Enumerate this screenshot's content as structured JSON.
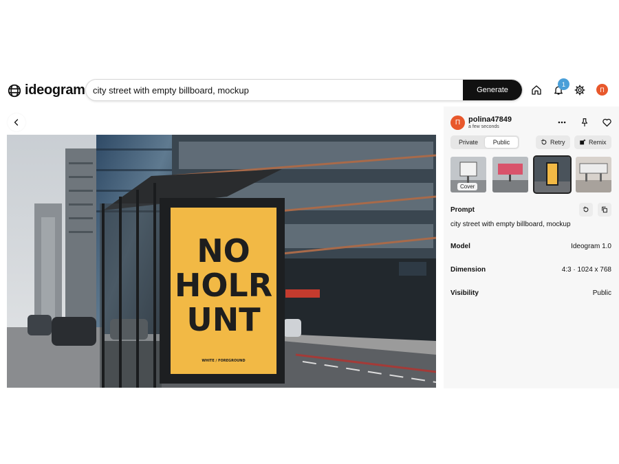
{
  "app": {
    "logo_text": "ideogram"
  },
  "search": {
    "value": "city street with empty billboard, mockup",
    "generate_label": "Generate"
  },
  "header": {
    "notification_count": "1",
    "avatar_initial": "Π"
  },
  "image": {
    "poster_lines": [
      "NO",
      "HOLR",
      "UNT"
    ],
    "poster_small_text": "WHITE / FOREGROUND"
  },
  "panel": {
    "user": {
      "avatar_initial": "Π",
      "username": "polina47849",
      "timestamp": "a few seconds"
    },
    "visibility_options": [
      "Private",
      "Public"
    ],
    "retry_label": "Retry",
    "remix_label": "Remix",
    "cover_label": "Cover",
    "prompt_label": "Prompt",
    "prompt_text": "city street with empty billboard, mockup",
    "model_label": "Model",
    "model_value": "Ideogram 1.0",
    "dimension_label": "Dimension",
    "dimension_value": "4:3 · 1024 x 768",
    "visibility_label": "Visibility",
    "visibility_value": "Public"
  },
  "colors": {
    "accent_dark": "#111111",
    "avatar": "#e8582c",
    "badge": "#4a9fd8",
    "poster_yellow": "#f2b945"
  },
  "icons": [
    "logo-icon",
    "home-icon",
    "bell-icon",
    "gear-icon",
    "chevron-left-icon",
    "more-icon",
    "pin-icon",
    "heart-icon",
    "retry-icon",
    "remix-icon",
    "undo-icon",
    "copy-icon"
  ]
}
